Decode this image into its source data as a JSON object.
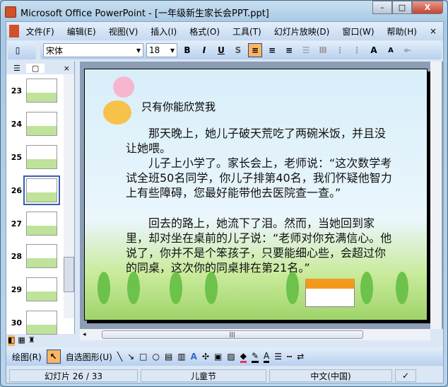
{
  "window": {
    "title": "Microsoft Office PowerPoint - [一年级新生家长会PPT.ppt]",
    "minimize": "–",
    "maximize": "□",
    "close": "X"
  },
  "menu": [
    "文件(F)",
    "编辑(E)",
    "视图(V)",
    "插入(I)",
    "格式(O)",
    "工具(T)",
    "幻灯片放映(D)",
    "窗口(W)",
    "帮助(H)"
  ],
  "menu_close": "×",
  "format": {
    "font": "宋体",
    "size": "18",
    "bold": "B",
    "italic": "I",
    "underline": "U",
    "shadow": "S",
    "grow": "A",
    "shrink": "A"
  },
  "left_pane": {
    "close": "×",
    "thumbs": [
      "23",
      "24",
      "25",
      "26",
      "27",
      "28",
      "29",
      "30"
    ],
    "selected": "26"
  },
  "slide": {
    "title": "只有你能欣赏我",
    "paragraphs": [
      "那天晚上，她儿子破天荒吃了两碗米饭，并且没让她喂。",
      "儿子上小学了。家长会上，老师说：“这次数学考试全班50名同学，你儿子排第40名，我们怀疑他智力上有些障碍，您最好能带他去医院查一查。”",
      "回去的路上，她流下了泪。然而，当她回到家里，却对坐在桌前的儿子说：“老师对你充满信心。他说了，你并不是个笨孩子，只要能细心些，会超过你的同桌，这次你的同桌排在第21名。”"
    ]
  },
  "drawbar": {
    "draw": "绘图(R)",
    "autoshapes": "自选图形(U)"
  },
  "status": {
    "slide": "幻灯片 26 / 33",
    "design": "儿童节",
    "language": "中文(中国)"
  },
  "colors": {
    "accent": "#fbb563",
    "fill": "#e8316e"
  }
}
